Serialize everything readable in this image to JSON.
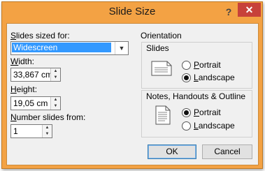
{
  "dialog": {
    "title": "Slide Size",
    "help_glyph": "?",
    "close_glyph": "✕"
  },
  "slides_sized_for": {
    "label_accel": "S",
    "label_rest": "lides sized for:",
    "value": "Widescreen"
  },
  "width": {
    "label_accel": "W",
    "label_rest": "idth:",
    "value": "33,867 cm"
  },
  "height": {
    "label_accel": "H",
    "label_rest": "eight:",
    "value": "19,05 cm"
  },
  "number_slides_from": {
    "label_accel": "N",
    "label_rest": "umber slides from:",
    "value": "1"
  },
  "orientation": {
    "heading": "Orientation",
    "slides": {
      "heading": "Slides",
      "portrait_accel": "P",
      "portrait_rest": "ortrait",
      "landscape_accel": "L",
      "landscape_rest": "andscape",
      "selected": "Landscape"
    },
    "notes": {
      "heading": "Notes, Handouts & Outline",
      "portrait_accel": "P",
      "portrait_rest": "ortrait",
      "landscape_accel": "L",
      "landscape_rest": "andscape",
      "selected": "Portrait"
    }
  },
  "buttons": {
    "ok": "OK",
    "cancel": "Cancel"
  },
  "colors": {
    "title_bar": "#f3a244",
    "close_button": "#c7413a",
    "selection": "#3399ff",
    "dialog_body": "#f0f0f0"
  },
  "icons": {
    "help": "help-icon",
    "close": "close-icon",
    "dropdown": "chevron-down-icon",
    "spin_up": "spin-up-icon",
    "spin_down": "spin-down-icon",
    "landscape_page": "landscape-page-icon",
    "portrait_page": "portrait-page-icon"
  }
}
